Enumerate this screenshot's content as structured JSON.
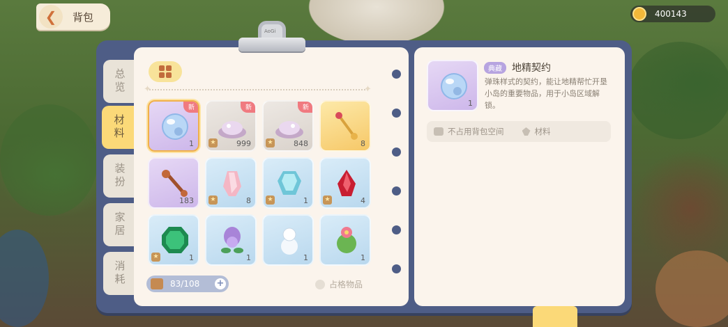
{
  "header": {
    "title": "背包",
    "back_icon": "chevron-left-icon"
  },
  "currency": {
    "amount": "400143",
    "icon": "coin-icon"
  },
  "side_tabs": [
    {
      "label": "总览",
      "active": false
    },
    {
      "label": "材料",
      "active": true
    },
    {
      "label": "装扮",
      "active": false
    },
    {
      "label": "家居",
      "active": false
    },
    {
      "label": "消耗",
      "active": false
    }
  ],
  "clipboard": {
    "brand": "AoGi"
  },
  "filter": {
    "icon": "grid-filter-icon"
  },
  "items": [
    {
      "name": "marble-orb",
      "count": "1",
      "new": true,
      "star": false,
      "bg": "purple",
      "selected": true
    },
    {
      "name": "pink-dust-pile",
      "count": "999",
      "new": true,
      "star": true,
      "bg": "gray"
    },
    {
      "name": "pink-dust-pile",
      "count": "848",
      "new": true,
      "star": true,
      "bg": "gray"
    },
    {
      "name": "golden-wand",
      "count": "8",
      "new": false,
      "star": false,
      "bg": "gold"
    },
    {
      "name": "wooden-key",
      "count": "183",
      "new": false,
      "star": false,
      "bg": "purple"
    },
    {
      "name": "pink-crystal",
      "count": "8",
      "new": false,
      "star": true,
      "bg": "blue"
    },
    {
      "name": "aqua-gem",
      "count": "1",
      "new": false,
      "star": true,
      "bg": "blue"
    },
    {
      "name": "red-crystal",
      "count": "4",
      "new": false,
      "star": true,
      "bg": "blue"
    },
    {
      "name": "green-emerald",
      "count": "1",
      "new": false,
      "star": true,
      "bg": "blue"
    },
    {
      "name": "purple-flower",
      "count": "1",
      "new": false,
      "star": false,
      "bg": "blue"
    },
    {
      "name": "snowman-figure",
      "count": "1",
      "new": false,
      "star": false,
      "bg": "blue"
    },
    {
      "name": "cactus-flower",
      "count": "1",
      "new": false,
      "star": false,
      "bg": "blue"
    }
  ],
  "badges": {
    "new_label": "新",
    "star": "★"
  },
  "capacity": {
    "text": "83/108",
    "plus": "+"
  },
  "slot_toggle": {
    "label": "占格物品"
  },
  "detail": {
    "count": "1",
    "tag": "典藏",
    "name": "地精契约",
    "description": "弹珠样式的契约，能让地精帮忙开垦小岛的重要物品，用于小岛区域解锁。",
    "meta": [
      {
        "icon": "bag-icon",
        "text": "不占用背包空间"
      },
      {
        "icon": "leaf-icon",
        "text": "材料"
      }
    ]
  },
  "colors": {
    "board": "#4e5d86",
    "accent": "#fbd978",
    "new_badge": "#f07a80",
    "panel": "#fbf4ec"
  }
}
